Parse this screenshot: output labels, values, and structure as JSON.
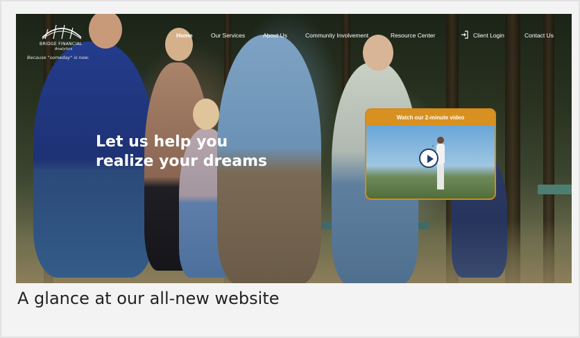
{
  "brand": {
    "name": "BRIDGE FINANCIAL",
    "sub": "Analytics",
    "tagline": "Because \"someday\" is now."
  },
  "nav": {
    "items": [
      {
        "label": "Home",
        "active": true
      },
      {
        "label": "Our Services"
      },
      {
        "label": "About Us"
      },
      {
        "label": "Community Involvement"
      },
      {
        "label": "Resource Center"
      },
      {
        "label": "Client Login"
      },
      {
        "label": "Contact Us"
      }
    ]
  },
  "hero": {
    "headline_line1": "Let us help you",
    "headline_line2": "realize your dreams"
  },
  "video": {
    "title": "Watch our 2-minute video"
  },
  "caption": "A glance at our all-new website",
  "colors": {
    "accent": "#d89121",
    "play_icon": "#1f3c6c"
  }
}
